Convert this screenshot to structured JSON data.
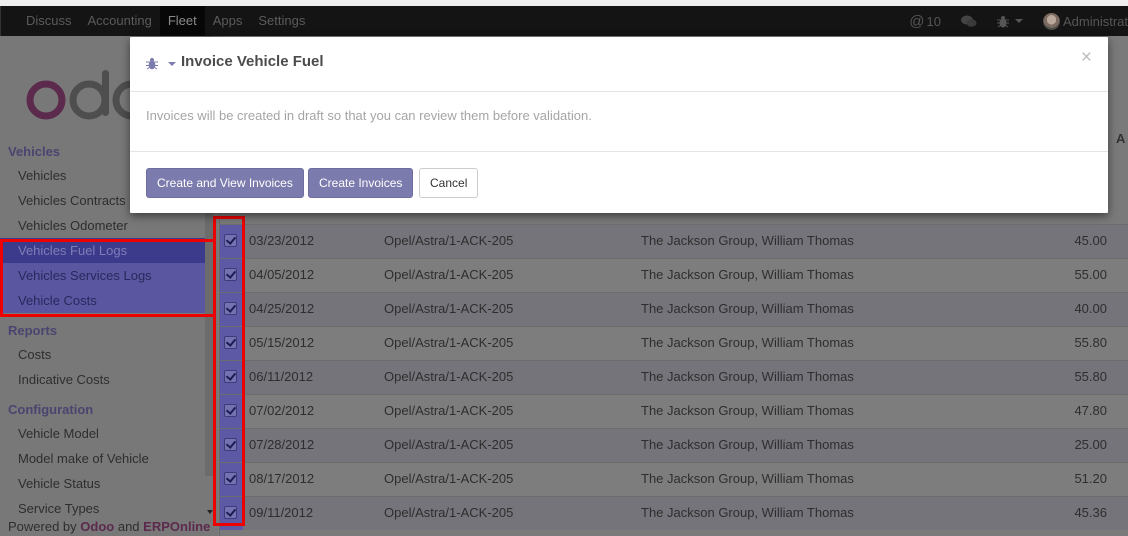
{
  "navbar": {
    "menu": [
      {
        "label": "Discuss",
        "active": false
      },
      {
        "label": "Accounting",
        "active": false
      },
      {
        "label": "Fleet",
        "active": true
      },
      {
        "label": "Apps",
        "active": false
      },
      {
        "label": "Settings",
        "active": false
      }
    ],
    "mentions_count": "10",
    "mentions_symbol": "@",
    "user_name": "Administrat"
  },
  "sidebar": {
    "sections": [
      {
        "title": "Vehicles",
        "items": [
          {
            "label": "Vehicles"
          },
          {
            "label": "Vehicles Contracts"
          },
          {
            "label": "Vehicles Odometer"
          },
          {
            "label": "Vehicles Fuel Logs",
            "active": true
          },
          {
            "label": "Vehicles Services Logs"
          },
          {
            "label": "Vehicle Costs"
          }
        ]
      },
      {
        "title": "Reports",
        "items": [
          {
            "label": "Costs"
          },
          {
            "label": "Indicative Costs"
          }
        ]
      },
      {
        "title": "Configuration",
        "items": [
          {
            "label": "Vehicle Model"
          },
          {
            "label": "Model make of Vehicle"
          },
          {
            "label": "Vehicle Status"
          },
          {
            "label": "Service Types"
          }
        ]
      }
    ],
    "powered_by": {
      "prefix": "Powered by",
      "brand1": "Odoo",
      "joiner": "and",
      "brand2": "ERPOnline"
    }
  },
  "list": {
    "partial_header": "A",
    "rows": [
      {
        "date": "03/23/2012",
        "vehicle": "Opel/Astra/1-ACK-205",
        "partner": "The Jackson Group, William Thomas",
        "amount": "45.00",
        "checked": true
      },
      {
        "date": "04/05/2012",
        "vehicle": "Opel/Astra/1-ACK-205",
        "partner": "The Jackson Group, William Thomas",
        "amount": "55.00",
        "checked": true
      },
      {
        "date": "04/25/2012",
        "vehicle": "Opel/Astra/1-ACK-205",
        "partner": "The Jackson Group, William Thomas",
        "amount": "40.00",
        "checked": true
      },
      {
        "date": "05/15/2012",
        "vehicle": "Opel/Astra/1-ACK-205",
        "partner": "The Jackson Group, William Thomas",
        "amount": "55.80",
        "checked": true
      },
      {
        "date": "06/11/2012",
        "vehicle": "Opel/Astra/1-ACK-205",
        "partner": "The Jackson Group, William Thomas",
        "amount": "55.80",
        "checked": true
      },
      {
        "date": "07/02/2012",
        "vehicle": "Opel/Astra/1-ACK-205",
        "partner": "The Jackson Group, William Thomas",
        "amount": "47.80",
        "checked": true
      },
      {
        "date": "07/28/2012",
        "vehicle": "Opel/Astra/1-ACK-205",
        "partner": "The Jackson Group, William Thomas",
        "amount": "25.00",
        "checked": true
      },
      {
        "date": "08/17/2012",
        "vehicle": "Opel/Astra/1-ACK-205",
        "partner": "The Jackson Group, William Thomas",
        "amount": "51.20",
        "checked": true
      },
      {
        "date": "09/11/2012",
        "vehicle": "Opel/Astra/1-ACK-205",
        "partner": "The Jackson Group, William Thomas",
        "amount": "45.36",
        "checked": true
      }
    ]
  },
  "modal": {
    "title": "Invoice Vehicle Fuel",
    "close_symbol": "×",
    "message": "Invoices will be created in draft so that you can review them before validation.",
    "buttons": {
      "create_and_view": "Create and View Invoices",
      "create": "Create Invoices",
      "cancel": "Cancel"
    }
  },
  "colors": {
    "brand_primary": "#7c7bad",
    "highlight_red": "#ec0000",
    "logo_o": "#5c2a4c"
  }
}
